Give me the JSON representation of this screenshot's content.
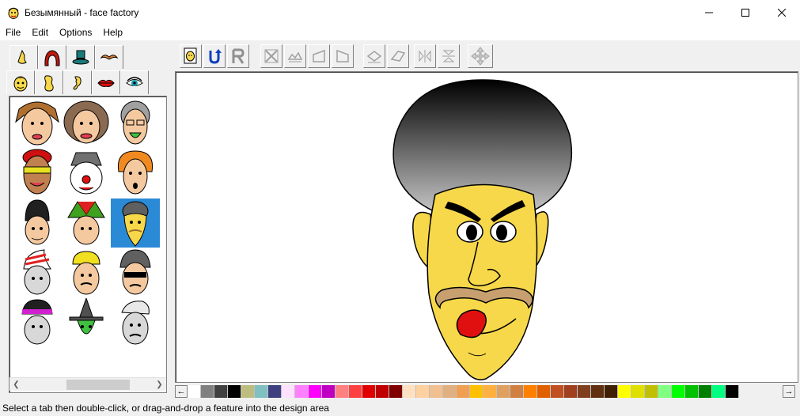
{
  "window": {
    "title": "Безымянный - face factory"
  },
  "menu": [
    "File",
    "Edit",
    "Options",
    "Help"
  ],
  "tabs": {
    "row1": [
      "nose-icon",
      "hair-icon",
      "hat-icon",
      "mustache-icon"
    ],
    "row2": [
      "face-icon",
      "head-shape-icon",
      "ear-icon",
      "lips-icon",
      "eye-icon"
    ],
    "active": "face-icon"
  },
  "palette": {
    "selected_index": 8,
    "item_count": 15
  },
  "toolbar": {
    "buttons": [
      "new-face-icon",
      "undo-icon",
      "redo-icon",
      "flip-1-icon",
      "flip-2-icon",
      "flip-3-icon",
      "flip-4-icon",
      "rotate-1-icon",
      "rotate-2-icon",
      "mirror-1-icon",
      "mirror-2-icon",
      "move-icon"
    ]
  },
  "colors": [
    "#ffffff",
    "#808080",
    "#404040",
    "#000000",
    "#bdbd80",
    "#80c0c0",
    "#404080",
    "#ffe0ff",
    "#ff80ff",
    "#ff00ff",
    "#c000c0",
    "#ff8080",
    "#ff4040",
    "#e00000",
    "#c00000",
    "#800000",
    "#ffe0c0",
    "#ffd0a0",
    "#f0c090",
    "#e0b080",
    "#f0a050",
    "#ffc000",
    "#ffb040",
    "#e0a060",
    "#d08040",
    "#ff8000",
    "#e06000",
    "#c05020",
    "#a04020",
    "#804020",
    "#603010",
    "#402000",
    "#ffff00",
    "#e0e000",
    "#c0c000",
    "#80ff80",
    "#00ff00",
    "#00c000",
    "#008000",
    "#00ff80",
    "#000000"
  ],
  "status": {
    "text": "Select a tab then double-click, or drag-and-drop a feature into the design area"
  }
}
